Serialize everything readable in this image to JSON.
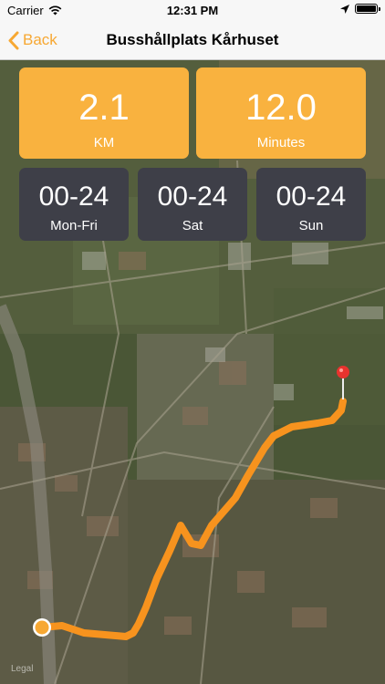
{
  "status_bar": {
    "carrier": "Carrier",
    "time": "12:31 PM"
  },
  "nav": {
    "back_label": "Back",
    "title": "Busshållplats Kårhuset"
  },
  "stats": {
    "distance": {
      "value": "2.1",
      "unit": "KM"
    },
    "duration": {
      "value": "12.0",
      "unit": "Minutes"
    }
  },
  "schedule": [
    {
      "hours": "00-24",
      "label": "Mon-Fri"
    },
    {
      "hours": "00-24",
      "label": "Sat"
    },
    {
      "hours": "00-24",
      "label": "Sun"
    }
  ],
  "map": {
    "legal_label": "Legal",
    "route_color": "#f7931e",
    "start_marker_color": "#f7a833",
    "destination_pin_color": "#e8332e"
  }
}
